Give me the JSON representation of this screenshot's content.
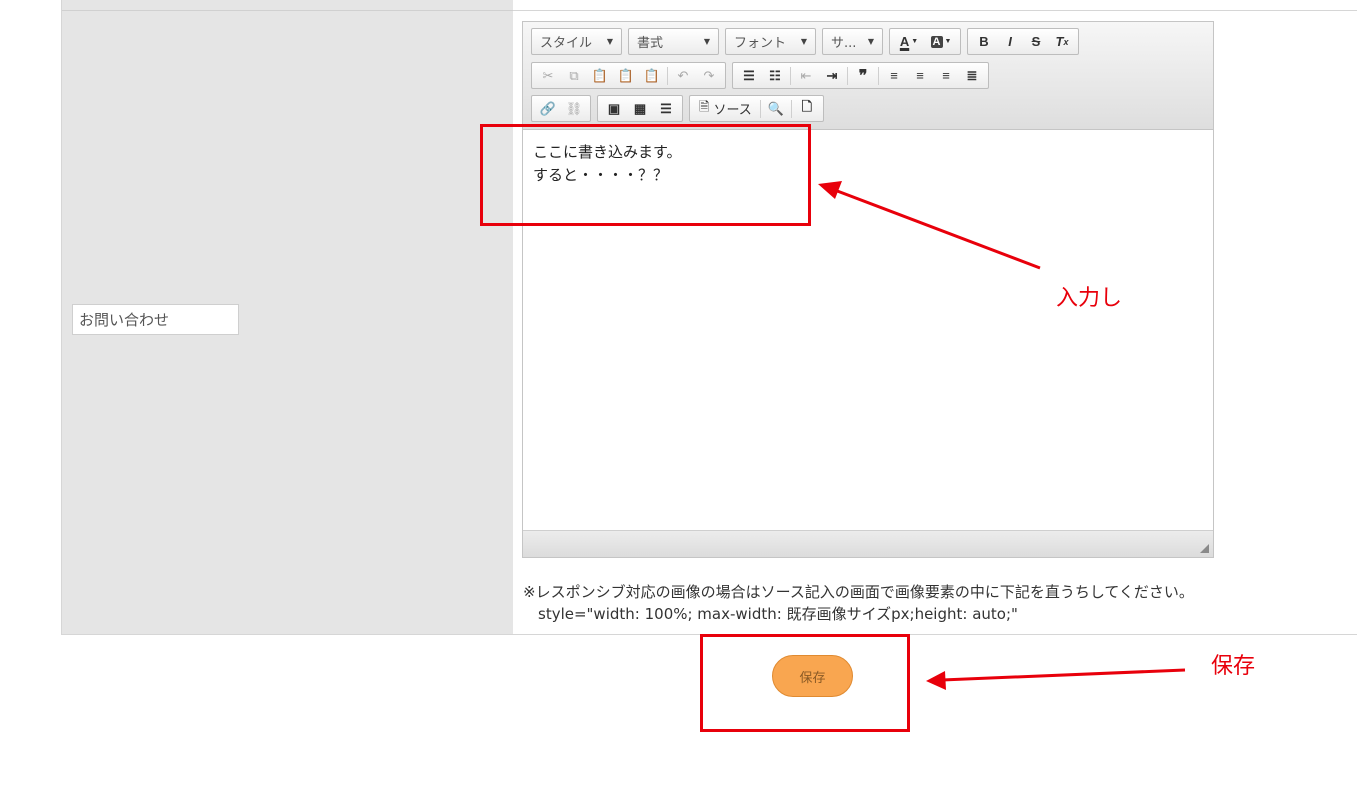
{
  "form": {
    "label_value": "お問い合わせ"
  },
  "editor": {
    "toolbar": {
      "combos": [
        "スタイル",
        "書式",
        "フォント",
        "サ..."
      ],
      "source_label": "ソース"
    },
    "content_lines": [
      "ここに書き込みます。",
      "すると・・・・？？"
    ]
  },
  "note": {
    "line1": "※レスポンシブ対応の画像の場合はソース記入の画面で画像要素の中に下記を直うちしてください。",
    "line2": "style=\"width: 100%; max-width: 既存画像サイズpx;height: auto;\""
  },
  "save_button": {
    "label": "保存"
  },
  "annotations": {
    "input_label": "入力し",
    "save_label": "保存",
    "color": "#e8000b"
  }
}
